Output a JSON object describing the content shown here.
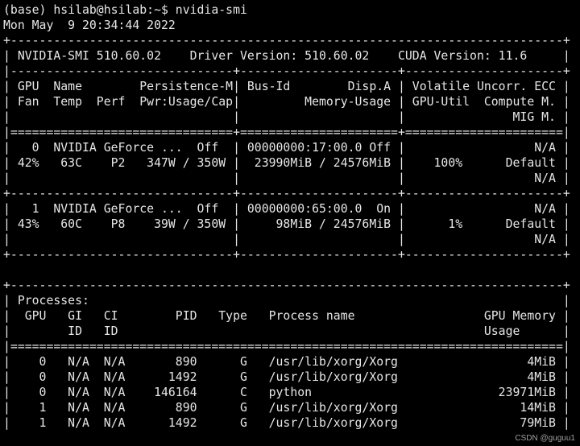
{
  "terminal": {
    "prompt": "(base) hsilab@hsilab:~$ nvidia-smi",
    "timestamp": "Mon May  9 20:34:44 2022",
    "lines": [
      "+-----------------------------------------------------------------------------+",
      "| NVIDIA-SMI 510.60.02    Driver Version: 510.60.02    CUDA Version: 11.6     |",
      "|-------------------------------+----------------------+----------------------+",
      "| GPU  Name        Persistence-M| Bus-Id        Disp.A | Volatile Uncorr. ECC |",
      "| Fan  Temp  Perf  Pwr:Usage/Cap|         Memory-Usage | GPU-Util  Compute M. |",
      "|                               |                      |               MIG M. |",
      "|===============================+======================+======================|",
      "|   0  NVIDIA GeForce ...  Off  | 00000000:17:00.0 Off |                  N/A |",
      "| 42%   63C    P2   347W / 350W |  23990MiB / 24576MiB |    100%      Default |",
      "|                               |                      |                  N/A |",
      "+-------------------------------+----------------------+----------------------+",
      "|   1  NVIDIA GeForce ...  Off  | 00000000:65:00.0  On |                  N/A |",
      "| 43%   60C    P8    39W / 350W |     98MiB / 24576MiB |      1%      Default |",
      "|                               |                      |                  N/A |",
      "+-------------------------------+----------------------+----------------------+",
      "",
      "+-----------------------------------------------------------------------------+",
      "| Processes:                                                                  |",
      "|  GPU   GI   CI        PID   Type   Process name                  GPU Memory |",
      "|        ID   ID                                                   Usage      |",
      "|=============================================================================|",
      "|    0   N/A  N/A       890      G   /usr/lib/xorg/Xorg                  4MiB |",
      "|    0   N/A  N/A      1492      G   /usr/lib/xorg/Xorg                  4MiB |",
      "|    0   N/A  N/A    146164      C   python                          23971MiB |",
      "|    1   N/A  N/A       890      G   /usr/lib/xorg/Xorg                 14MiB |",
      "|    1   N/A  N/A      1492      G   /usr/lib/xorg/Xorg                 79MiB |"
    ]
  },
  "watermark": "CSDN @guguu1"
}
